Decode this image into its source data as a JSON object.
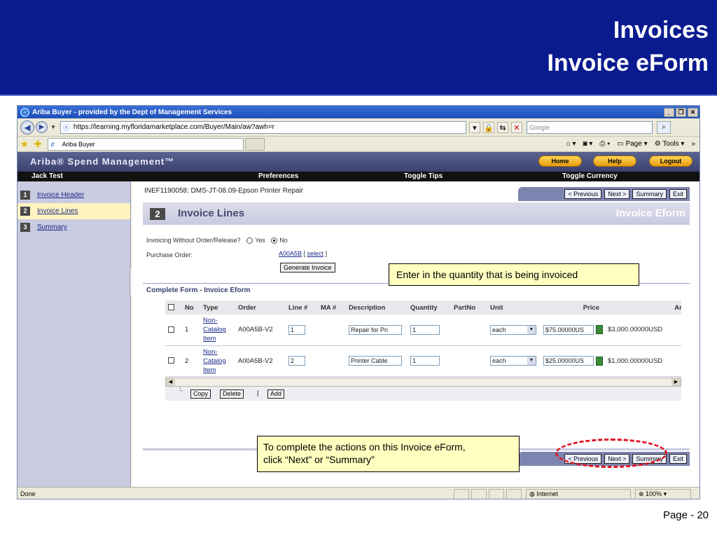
{
  "slide": {
    "title_line1": "Invoices",
    "title_line2": "Invoice eForm",
    "page_number": "Page - 20"
  },
  "browser": {
    "window_title": "Ariba Buyer - provided by the Dept of Management Services",
    "url": "https://learning.myfloridamarketplace.com/Buyer/Main/aw?awh=r",
    "search_placeholder": "Google",
    "tab_label": "Ariba Buyer",
    "page_menu": "Page",
    "tools_menu": "Tools",
    "status_done": "Done",
    "status_zone": "Internet",
    "status_zoom": "100%"
  },
  "ariba": {
    "app_title": "Ariba® Spend Management™",
    "home": "Home",
    "help": "Help",
    "logout": "Logout",
    "user": "Jack Test",
    "nav_preferences": "Preferences",
    "nav_toggle_tips": "Toggle Tips",
    "nav_toggle_currency": "Toggle Currency"
  },
  "steps": [
    {
      "num": "1",
      "label": "Invoice Header"
    },
    {
      "num": "2",
      "label": "Invoice Lines"
    },
    {
      "num": "3",
      "label": "Summary"
    }
  ],
  "main": {
    "doc_id": "INEF1190058: DMS-JT-08.09-Epson Printer Repair",
    "btn_previous": "< Previous",
    "btn_next": "Next >",
    "btn_summary": "Summary",
    "btn_exit": "Exit",
    "step_num": "2",
    "banner_title": "Invoice Lines",
    "banner_right": "Invoice Eform",
    "invoicing_label": "Invoicing Without Order/Release?",
    "yes": "Yes",
    "no": "No",
    "po_label": "Purchase Order:",
    "po_value": "A00A5B",
    "select_link": "select",
    "generate_invoice": "Generate Invoice",
    "section_title": "Complete Form - Invoice Eform",
    "copy": "Copy",
    "delete": "Delete",
    "add": "Add"
  },
  "table": {
    "headers": [
      "No",
      "Type",
      "Order",
      "Line #",
      "MA #",
      "Description",
      "Quantity",
      "PartNo",
      "Unit",
      "Price",
      "Amoun"
    ],
    "rows": [
      {
        "no": "1",
        "type1": "Non-",
        "type2": "Catalog",
        "type3": "Item",
        "order": "A00A5B-V2",
        "line": "1",
        "ma": "",
        "description": "Repair for Pri",
        "quantity": "1",
        "partno": "",
        "unit": "each",
        "price": "$75.00000US",
        "amount": "$3,000.00000USD"
      },
      {
        "no": "2",
        "type1": "Non-",
        "type2": "Catalog",
        "type3": "Item",
        "order": "A00A5B-V2",
        "line": "2",
        "ma": "",
        "description": "Printer Cable",
        "quantity": "1",
        "partno": "",
        "unit": "each",
        "price": "$25.00000US",
        "amount": "$1,000.00000USD"
      }
    ]
  },
  "callouts": {
    "quantity_note": "Enter in the quantity that is being invoiced",
    "actions_note_1": "To complete the actions on this Invoice eForm,",
    "actions_note_2": "click “Next” or “Summary”"
  }
}
